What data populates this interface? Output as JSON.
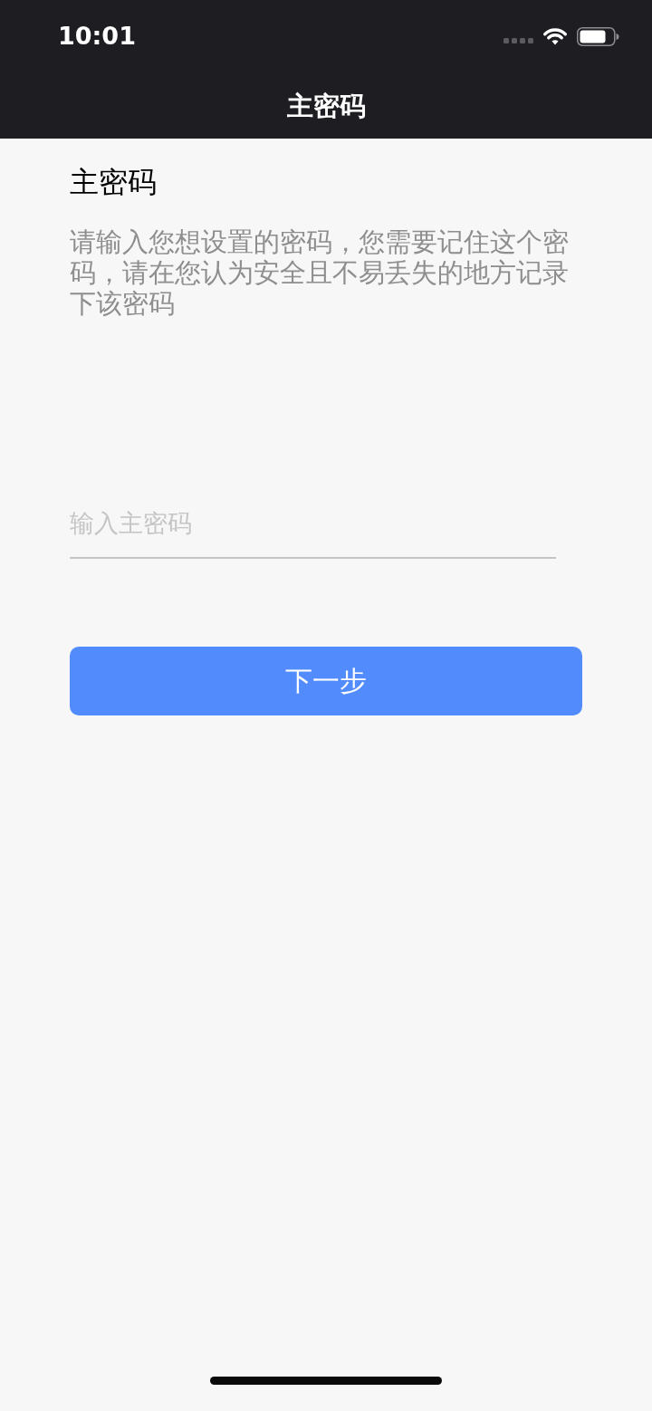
{
  "status_bar": {
    "time": "10:01"
  },
  "nav_bar": {
    "title": "主密码"
  },
  "heading": "主密码",
  "description": "请输入您想设置的密码，您需要记住这个密码，请在您认为安全且不易丢失的地方记录下该密码",
  "password_field": {
    "placeholder": "输入主密码"
  },
  "next_button": {
    "label": "下一步"
  }
}
